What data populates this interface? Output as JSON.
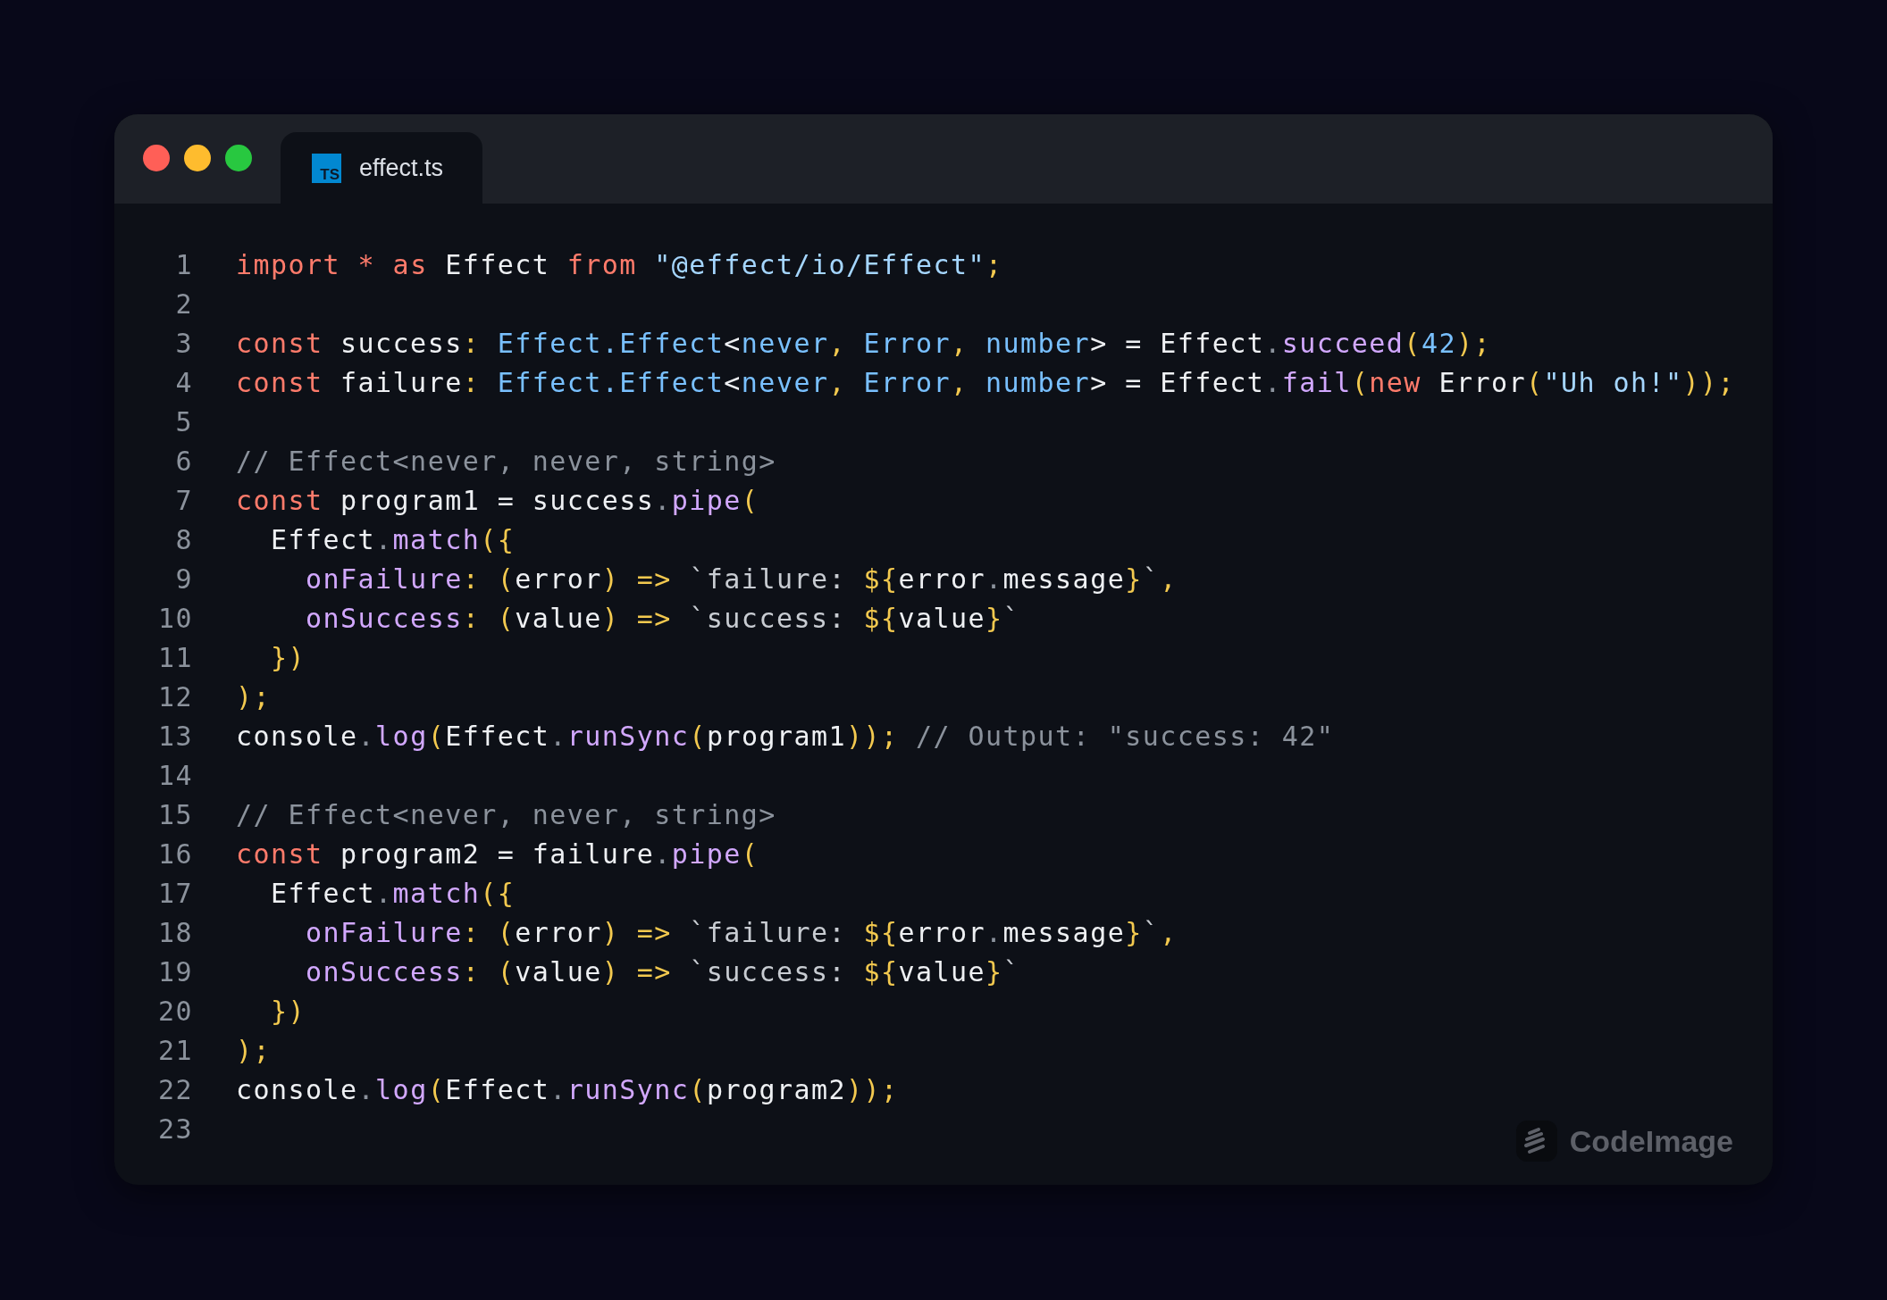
{
  "window": {
    "controls": [
      {
        "color": "#ff5f57"
      },
      {
        "color": "#febc2e"
      },
      {
        "color": "#28c840"
      }
    ],
    "tabs": [
      {
        "badge": "TS",
        "label": "effect.ts",
        "selected": true
      }
    ]
  },
  "code": {
    "lines": [
      {
        "number": "1",
        "tokens": [
          {
            "text": "import",
            "kind": "kw"
          },
          {
            "text": " *",
            "kind": "kw"
          },
          {
            "text": " as",
            "kind": "kw"
          },
          {
            "text": " Effect "
          },
          {
            "text": "from",
            "kind": "kw"
          },
          {
            "text": " \"@effect/io/Effect\"",
            "kind": "str"
          },
          {
            "text": ";",
            "kind": "punc"
          }
        ]
      },
      {
        "number": "2"
      },
      {
        "number": "3",
        "tokens": [
          {
            "text": "const",
            "kind": "kw"
          },
          {
            "text": " success"
          },
          {
            "text": ":",
            "kind": "punc"
          },
          {
            "text": " Effect.Effect",
            "kind": "type"
          },
          {
            "text": "<"
          },
          {
            "text": "never",
            "kind": "type"
          },
          {
            "text": ",",
            "kind": "punc"
          },
          {
            "text": " Error",
            "kind": "type"
          },
          {
            "text": ",",
            "kind": "punc"
          },
          {
            "text": " number",
            "kind": "type"
          },
          {
            "text": "> = Effect"
          },
          {
            "text": ".",
            "kind": "dot"
          },
          {
            "text": "succeed",
            "kind": "fn"
          },
          {
            "text": "(",
            "kind": "punc"
          },
          {
            "text": "42",
            "kind": "type"
          },
          {
            "text": ");",
            "kind": "punc"
          }
        ]
      },
      {
        "number": "4",
        "tokens": [
          {
            "text": "const",
            "kind": "kw"
          },
          {
            "text": " failure"
          },
          {
            "text": ":",
            "kind": "punc"
          },
          {
            "text": " Effect.Effect",
            "kind": "type"
          },
          {
            "text": "<"
          },
          {
            "text": "never",
            "kind": "type"
          },
          {
            "text": ",",
            "kind": "punc"
          },
          {
            "text": " Error",
            "kind": "type"
          },
          {
            "text": ",",
            "kind": "punc"
          },
          {
            "text": " number",
            "kind": "type"
          },
          {
            "text": "> = Effect"
          },
          {
            "text": ".",
            "kind": "dot"
          },
          {
            "text": "fail",
            "kind": "fn"
          },
          {
            "text": "(",
            "kind": "punc"
          },
          {
            "text": "new",
            "kind": "kw"
          },
          {
            "text": " Error"
          },
          {
            "text": "(",
            "kind": "punc"
          },
          {
            "text": "\"Uh oh!\"",
            "kind": "str"
          },
          {
            "text": "));",
            "kind": "punc"
          }
        ]
      },
      {
        "number": "5"
      },
      {
        "number": "6",
        "tokens": [
          {
            "text": "// Effect<never, never, string>",
            "kind": "comment"
          }
        ]
      },
      {
        "number": "7",
        "tokens": [
          {
            "text": "const",
            "kind": "kw"
          },
          {
            "text": " program1 = success"
          },
          {
            "text": ".",
            "kind": "dot"
          },
          {
            "text": "pipe",
            "kind": "fn"
          },
          {
            "text": "(",
            "kind": "punc"
          }
        ]
      },
      {
        "number": "8",
        "tokens": [
          {
            "text": "  Effect"
          },
          {
            "text": ".",
            "kind": "dot"
          },
          {
            "text": "match",
            "kind": "fn"
          },
          {
            "text": "({",
            "kind": "punc"
          }
        ]
      },
      {
        "number": "9",
        "tokens": [
          {
            "text": "    onFailure",
            "kind": "fn"
          },
          {
            "text": ":",
            "kind": "punc"
          },
          {
            "text": " (",
            "kind": "punc"
          },
          {
            "text": "error"
          },
          {
            "text": ")",
            "kind": "punc"
          },
          {
            "text": " =>",
            "kind": "punc"
          },
          {
            "text": " `failure: ",
            "kind": "tpl"
          },
          {
            "text": "${",
            "kind": "punc"
          },
          {
            "text": "error"
          },
          {
            "text": ".",
            "kind": "dot"
          },
          {
            "text": "message"
          },
          {
            "text": "}",
            "kind": "punc"
          },
          {
            "text": "`",
            "kind": "tpl"
          },
          {
            "text": ",",
            "kind": "punc"
          }
        ]
      },
      {
        "number": "10",
        "tokens": [
          {
            "text": "    onSuccess",
            "kind": "fn"
          },
          {
            "text": ":",
            "kind": "punc"
          },
          {
            "text": " (",
            "kind": "punc"
          },
          {
            "text": "value"
          },
          {
            "text": ")",
            "kind": "punc"
          },
          {
            "text": " =>",
            "kind": "punc"
          },
          {
            "text": " `success: ",
            "kind": "tpl"
          },
          {
            "text": "${",
            "kind": "punc"
          },
          {
            "text": "value"
          },
          {
            "text": "}",
            "kind": "punc"
          },
          {
            "text": "`",
            "kind": "tpl"
          }
        ]
      },
      {
        "number": "11",
        "tokens": [
          {
            "text": "  })",
            "kind": "punc"
          }
        ]
      },
      {
        "number": "12",
        "tokens": [
          {
            "text": ");",
            "kind": "punc"
          }
        ]
      },
      {
        "number": "13",
        "tokens": [
          {
            "text": "console"
          },
          {
            "text": ".",
            "kind": "dot"
          },
          {
            "text": "log",
            "kind": "fn"
          },
          {
            "text": "(",
            "kind": "punc"
          },
          {
            "text": "Effect"
          },
          {
            "text": ".",
            "kind": "dot"
          },
          {
            "text": "runSync",
            "kind": "fn"
          },
          {
            "text": "(",
            "kind": "punc"
          },
          {
            "text": "program1"
          },
          {
            "text": "));",
            "kind": "punc"
          },
          {
            "text": " // Output: \"success: 42\"",
            "kind": "comment"
          }
        ]
      },
      {
        "number": "14"
      },
      {
        "number": "15",
        "tokens": [
          {
            "text": "// Effect<never, never, string>",
            "kind": "comment"
          }
        ]
      },
      {
        "number": "16",
        "tokens": [
          {
            "text": "const",
            "kind": "kw"
          },
          {
            "text": " program2 = failure"
          },
          {
            "text": ".",
            "kind": "dot"
          },
          {
            "text": "pipe",
            "kind": "fn"
          },
          {
            "text": "(",
            "kind": "punc"
          }
        ]
      },
      {
        "number": "17",
        "tokens": [
          {
            "text": "  Effect"
          },
          {
            "text": ".",
            "kind": "dot"
          },
          {
            "text": "match",
            "kind": "fn"
          },
          {
            "text": "({",
            "kind": "punc"
          }
        ]
      },
      {
        "number": "18",
        "tokens": [
          {
            "text": "    onFailure",
            "kind": "fn"
          },
          {
            "text": ":",
            "kind": "punc"
          },
          {
            "text": " (",
            "kind": "punc"
          },
          {
            "text": "error"
          },
          {
            "text": ")",
            "kind": "punc"
          },
          {
            "text": " =>",
            "kind": "punc"
          },
          {
            "text": " `failure: ",
            "kind": "tpl"
          },
          {
            "text": "${",
            "kind": "punc"
          },
          {
            "text": "error"
          },
          {
            "text": ".",
            "kind": "dot"
          },
          {
            "text": "message"
          },
          {
            "text": "}",
            "kind": "punc"
          },
          {
            "text": "`",
            "kind": "tpl"
          },
          {
            "text": ",",
            "kind": "punc"
          }
        ]
      },
      {
        "number": "19",
        "tokens": [
          {
            "text": "    onSuccess",
            "kind": "fn"
          },
          {
            "text": ":",
            "kind": "punc"
          },
          {
            "text": " (",
            "kind": "punc"
          },
          {
            "text": "value"
          },
          {
            "text": ")",
            "kind": "punc"
          },
          {
            "text": " =>",
            "kind": "punc"
          },
          {
            "text": " `success: ",
            "kind": "tpl"
          },
          {
            "text": "${",
            "kind": "punc"
          },
          {
            "text": "value"
          },
          {
            "text": "}",
            "kind": "punc"
          },
          {
            "text": "`",
            "kind": "tpl"
          }
        ]
      },
      {
        "number": "20",
        "tokens": [
          {
            "text": "  })",
            "kind": "punc"
          }
        ]
      },
      {
        "number": "21",
        "tokens": [
          {
            "text": ");",
            "kind": "punc"
          }
        ]
      },
      {
        "number": "22",
        "tokens": [
          {
            "text": "console"
          },
          {
            "text": ".",
            "kind": "dot"
          },
          {
            "text": "log",
            "kind": "fn"
          },
          {
            "text": "(",
            "kind": "punc"
          },
          {
            "text": "Effect"
          },
          {
            "text": ".",
            "kind": "dot"
          },
          {
            "text": "runSync",
            "kind": "fn"
          },
          {
            "text": "(",
            "kind": "punc"
          },
          {
            "text": "program2"
          },
          {
            "text": "));",
            "kind": "punc"
          }
        ]
      },
      {
        "number": "23"
      }
    ]
  },
  "brand": {
    "label": "CodeImage"
  }
}
